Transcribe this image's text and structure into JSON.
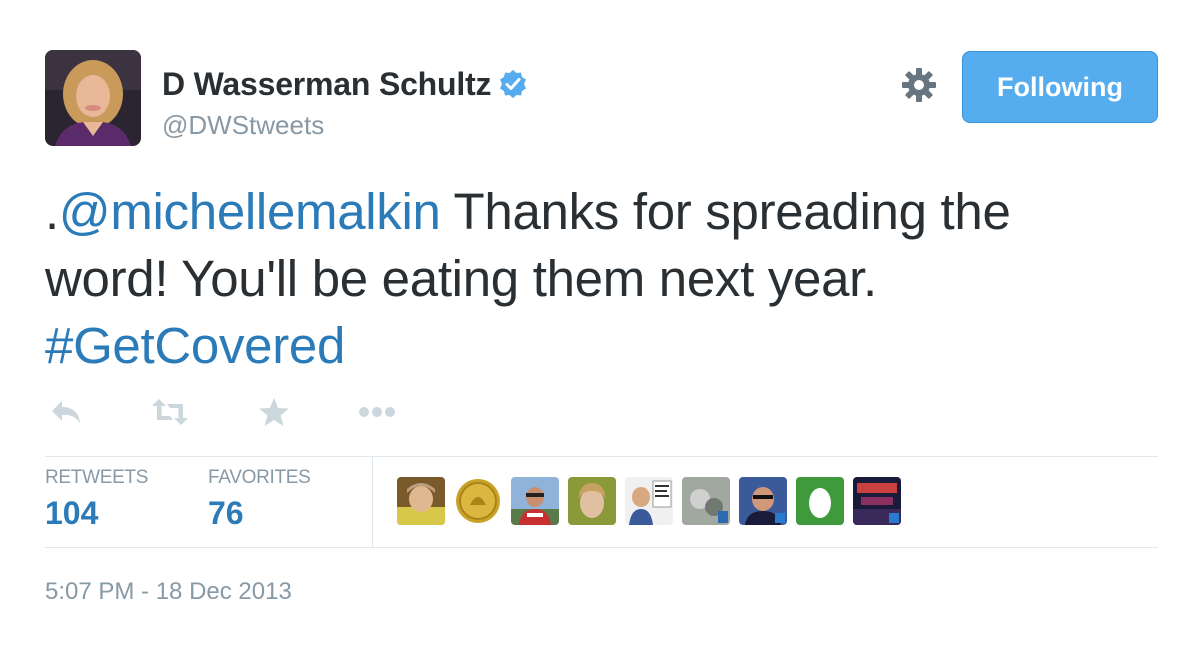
{
  "author": {
    "display_name": "D Wasserman Schultz",
    "handle": "@DWStweets",
    "verified": true,
    "avatar_icon": "profile-photo"
  },
  "follow_button": {
    "label": "Following",
    "color": "#55acee"
  },
  "settings_icon": "gear-icon",
  "tweet": {
    "prefix": ".",
    "mention": "@michellemalkin",
    "text_line1": " Thanks for spreading the",
    "text_line2": "word! You'll be eating them next year.",
    "hashtag": "#GetCovered",
    "link_color": "#2b7bb9"
  },
  "actions": [
    {
      "name": "reply",
      "icon": "reply-icon"
    },
    {
      "name": "retweet",
      "icon": "retweet-icon"
    },
    {
      "name": "favorite",
      "icon": "star-icon"
    },
    {
      "name": "more",
      "icon": "more-icon"
    }
  ],
  "stats": {
    "retweets_label": "RETWEETS",
    "retweets_value": "104",
    "favorites_label": "FAVORITES",
    "favorites_value": "76"
  },
  "favoriters": [
    {
      "icon": "user-avatar-1"
    },
    {
      "icon": "user-avatar-2-coin"
    },
    {
      "icon": "user-avatar-3"
    },
    {
      "icon": "user-avatar-4"
    },
    {
      "icon": "user-avatar-5"
    },
    {
      "icon": "user-avatar-6"
    },
    {
      "icon": "user-avatar-7"
    },
    {
      "icon": "user-avatar-8-egg"
    },
    {
      "icon": "user-avatar-9"
    }
  ],
  "timestamp": "5:07 PM - 18 Dec 2013"
}
